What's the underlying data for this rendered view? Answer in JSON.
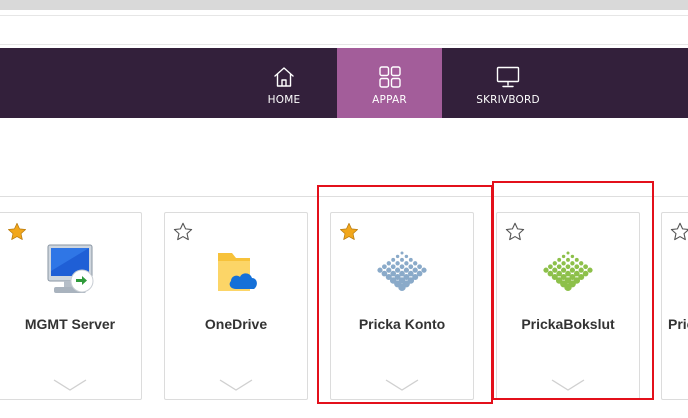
{
  "nav": {
    "tabs": [
      {
        "label": "HOME",
        "icon": "home-icon",
        "active": false
      },
      {
        "label": "APPAR",
        "icon": "apps-grid-icon",
        "active": true
      },
      {
        "label": "SKRIVBORD",
        "icon": "monitor-icon",
        "active": false
      }
    ]
  },
  "apps": [
    {
      "name": "MGMT Server",
      "favorite": true,
      "icon": "remote-desktop-icon"
    },
    {
      "name": "OneDrive",
      "favorite": false,
      "icon": "onedrive-folder-icon"
    },
    {
      "name": "Pricka Konto",
      "favorite": true,
      "icon": "pricka-dots-blue-icon"
    },
    {
      "name": "PrickaBokslut",
      "favorite": false,
      "icon": "pricka-dots-green-icon"
    },
    {
      "name": "Pric",
      "favorite": false,
      "icon": ""
    }
  ],
  "colors": {
    "nav_background": "#33203b",
    "nav_active": "#a35d9a",
    "star_filled": "#f2a71b",
    "highlight": "#e3101b",
    "pricka_blue": "#8aaac9",
    "pricka_green": "#8dc04a"
  }
}
